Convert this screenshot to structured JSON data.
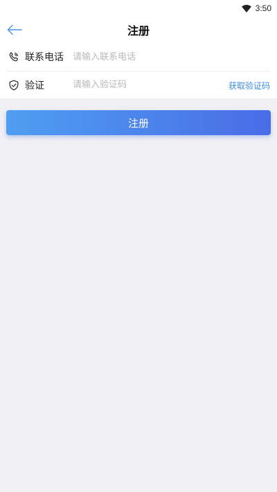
{
  "status_bar": {
    "time": "3:50",
    "wifi_icon": "wifi-icon"
  },
  "header": {
    "title": "注册",
    "back_icon": "back-arrow-icon"
  },
  "form": {
    "phone": {
      "icon": "phone-icon",
      "label": "联系电话",
      "placeholder": "请输入联系电话",
      "value": ""
    },
    "code": {
      "icon": "shield-check-icon",
      "label": "验证",
      "placeholder": "请输入验证码",
      "value": "",
      "get_code_label": "获取验证码"
    }
  },
  "submit_label": "注册",
  "colors": {
    "accent": "#3c8ce2",
    "button_start": "#4e9ef1",
    "button_end": "#4a6ce6",
    "background": "#efeff4"
  }
}
